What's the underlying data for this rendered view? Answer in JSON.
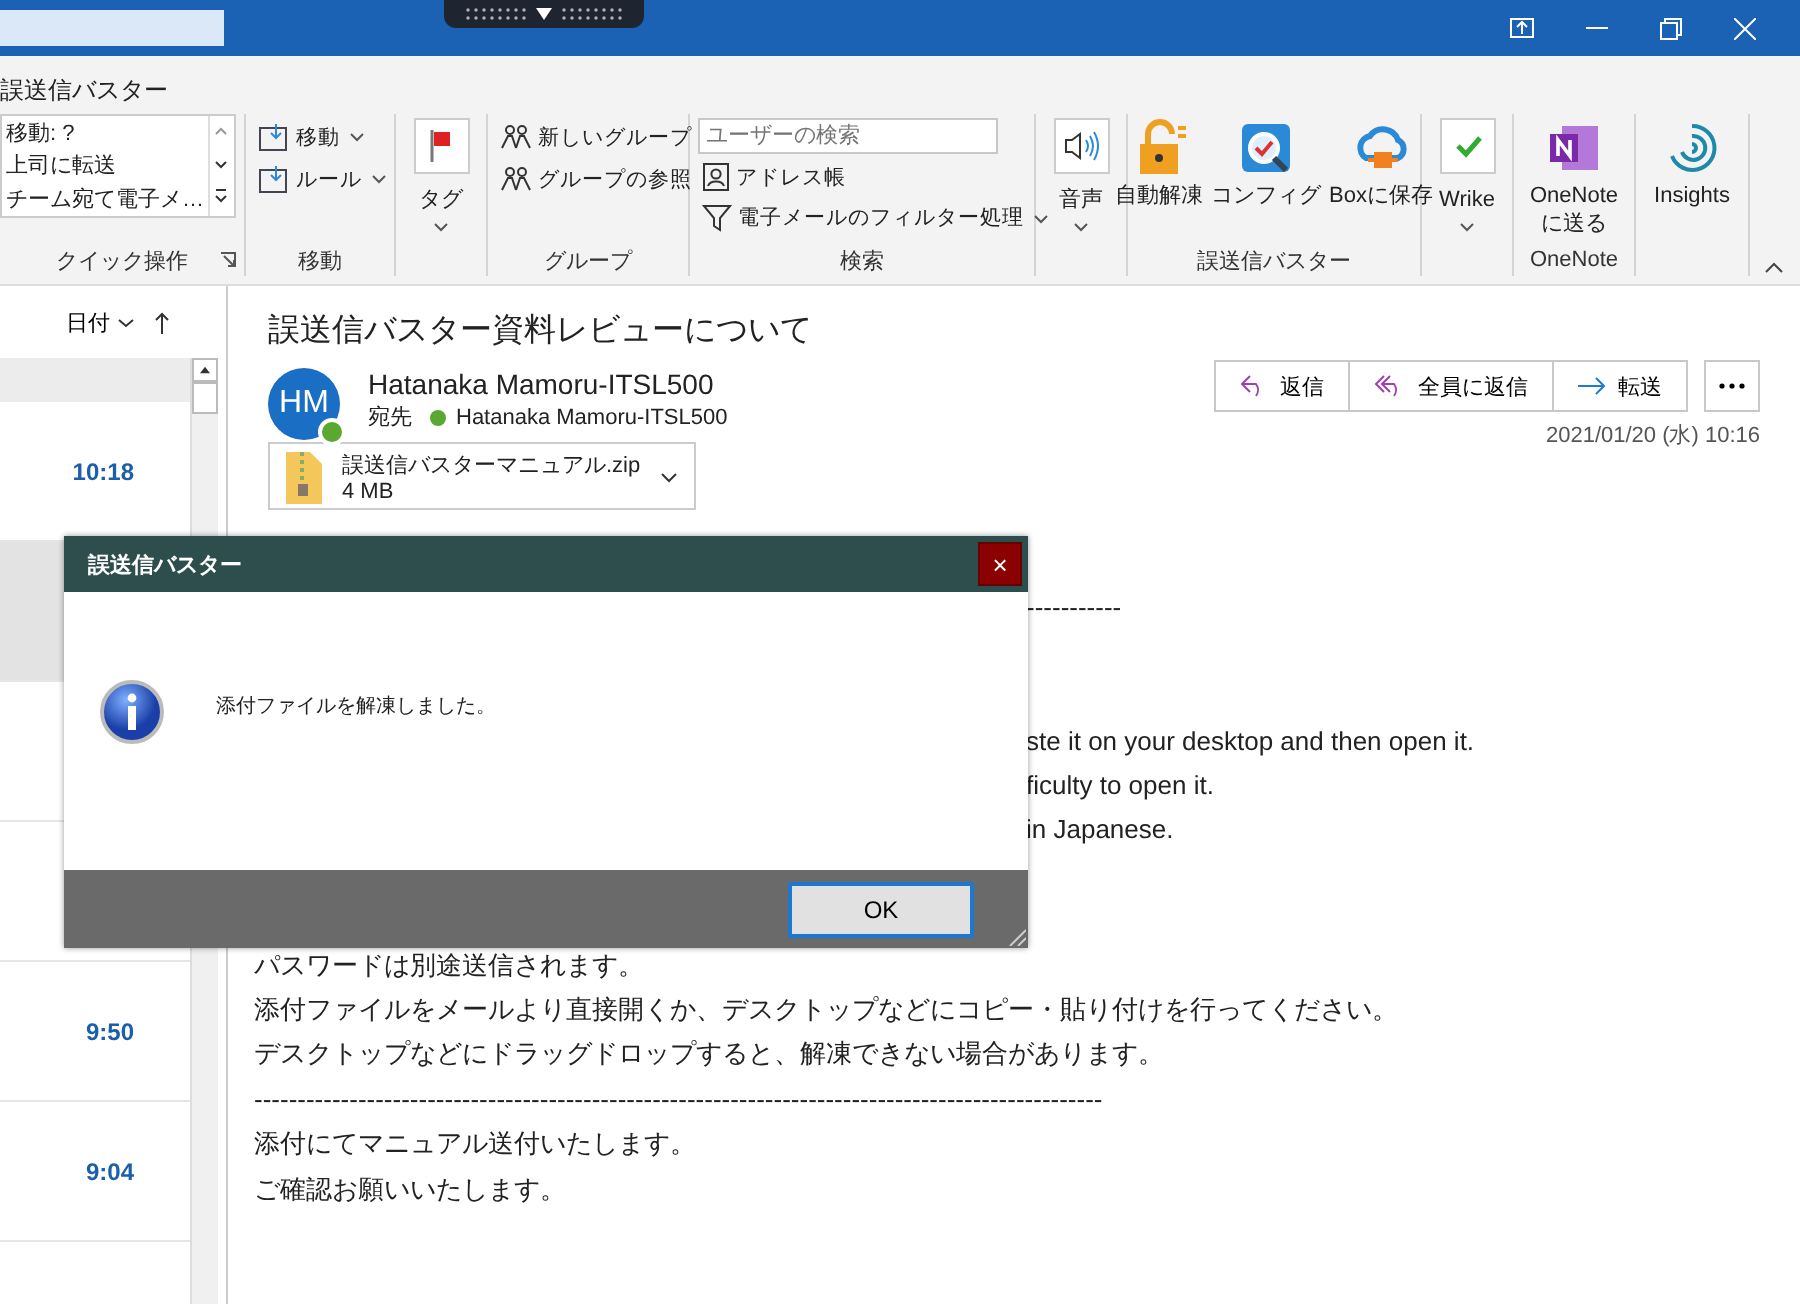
{
  "ribbon": {
    "title": "誤送信バスター",
    "groups": [
      {
        "kind": "quick",
        "label": "クイック操作",
        "items": [
          "移動: ?",
          "上司に転送",
          "チーム宛て電子メ…"
        ]
      },
      {
        "kind": "small",
        "label": "移動",
        "items": [
          {
            "label": "移動",
            "dropdown": true
          },
          {
            "label": "ルール",
            "dropdown": true
          }
        ]
      },
      {
        "kind": "large",
        "items": [
          {
            "label": "タグ",
            "dropdown": true
          }
        ]
      },
      {
        "kind": "small",
        "label": "グループ",
        "items": [
          {
            "label": "新しいグループ",
            "dropdown": false
          },
          {
            "label": "グループの参照",
            "dropdown": false
          }
        ]
      },
      {
        "kind": "search",
        "label": "検索",
        "placeholder": "ユーザーの検索",
        "items": [
          {
            "label": "アドレス帳",
            "dropdown": false
          },
          {
            "label": "電子メールのフィルター処理",
            "dropdown": true
          }
        ]
      },
      {
        "kind": "large",
        "items": [
          {
            "label": "音声",
            "dropdown": true
          }
        ]
      },
      {
        "kind": "large",
        "label": "誤送信バスター",
        "items": [
          {
            "label": "自動解凍",
            "dropdown": false
          },
          {
            "label": "コンフィグ",
            "dropdown": false
          },
          {
            "label": "Boxに保存",
            "dropdown": false
          }
        ]
      },
      {
        "kind": "large",
        "items": [
          {
            "label": "Wrike",
            "dropdown": true
          }
        ]
      },
      {
        "kind": "large",
        "label": "OneNote",
        "items": [
          {
            "label": "OneNote\nに送る",
            "dropdown": false
          }
        ]
      },
      {
        "kind": "large",
        "items": [
          {
            "label": "Insights",
            "dropdown": false
          }
        ]
      }
    ]
  },
  "message_list": {
    "sort_label": "日付",
    "rows": [
      {
        "time": "10:18",
        "selected": false
      },
      {
        "selected": true
      },
      {
        "selected": false
      },
      {
        "selected": false
      },
      {
        "time": "9:50",
        "selected": false
      },
      {
        "time": "9:04",
        "selected": false
      }
    ]
  },
  "message": {
    "subject": "誤送信バスター資料レビューについて",
    "avatar": "HM",
    "sender": "Hatanaka Mamoru-ITSL500",
    "to_label": "宛先",
    "recipient": "Hatanaka Mamoru-ITSL500",
    "actions": [
      "返信",
      "全員に返信",
      "転送"
    ],
    "date": "2021/01/20 (水) 10:16",
    "attachment": {
      "name": "誤送信バスターマニュアル.zip",
      "size": "4 MB"
    },
    "body": [
      {
        "kind": "cut",
        "text": "-----------"
      },
      {
        "kind": "gap"
      },
      {
        "kind": "gap"
      },
      {
        "kind": "cut",
        "text": "ste it on your desktop and then open it."
      },
      {
        "kind": "cut",
        "text": "ficulty to open it."
      },
      {
        "kind": "cut",
        "text": "in Japanese."
      },
      {
        "kind": "gap"
      },
      {
        "kind": "gap"
      },
      {
        "kind": "full",
        "text": "パスワードは別途送信されます。"
      },
      {
        "kind": "full",
        "text": "添付ファイルをメールより直接開くか、デスクトップなどにコピー・貼り付けを行ってください。"
      },
      {
        "kind": "full",
        "text": "デスクトップなどにドラッグドロップすると、解凍できない場合があります。"
      },
      {
        "kind": "full",
        "text": "--------------------------------------------------------------------------------------------------"
      },
      {
        "kind": "full",
        "text": "添付にてマニュアル送付いたします。"
      },
      {
        "kind": "full",
        "text": "ご確認お願いいたします。"
      }
    ]
  },
  "dialog": {
    "title": "誤送信バスター",
    "close": "×",
    "message": "添付ファイルを解凍しました。",
    "button": "OK"
  }
}
